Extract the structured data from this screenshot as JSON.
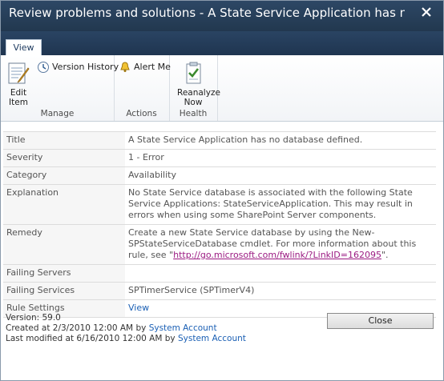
{
  "window": {
    "title": "Review problems and solutions - A State Service Application has no databas..."
  },
  "ribbon": {
    "tab": "View",
    "groups": {
      "manage": {
        "label": "Manage",
        "edit_item": "Edit Item",
        "version_history": "Version History"
      },
      "actions": {
        "label": "Actions",
        "alert_me": "Alert Me"
      },
      "health": {
        "label": "Health",
        "reanalyze_now": "Reanalyze Now"
      }
    }
  },
  "properties": [
    {
      "key": "Title",
      "value": "A State Service Application has no database defined."
    },
    {
      "key": "Severity",
      "value": "1 - Error"
    },
    {
      "key": "Category",
      "value": "Availability"
    },
    {
      "key": "Explanation",
      "value": "No State Service database is associated with the following State Service Applications: StateServiceApplication. This may result in errors when using some SharePoint Server components."
    },
    {
      "key": "Remedy",
      "value_pre": "Create a new State Service database by using the New-SPStateServiceDatabase cmdlet. For more information about this rule, see \"",
      "link": "http://go.microsoft.com/fwlink/?LinkID=162095",
      "value_post": "\"."
    },
    {
      "key": "Failing Servers",
      "value": ""
    },
    {
      "key": "Failing Services",
      "value": "SPTimerService (SPTimerV4)"
    },
    {
      "key": "Rule Settings",
      "link": "View"
    }
  ],
  "footer": {
    "version": "Version: 59.0",
    "created_prefix": "Created at 2/3/2010 12:00 AM  by",
    "created_by": "System Account",
    "modified_prefix": "Last modified at 6/16/2010 12:00 AM  by",
    "modified_by": "System Account"
  },
  "close_button": "Close"
}
